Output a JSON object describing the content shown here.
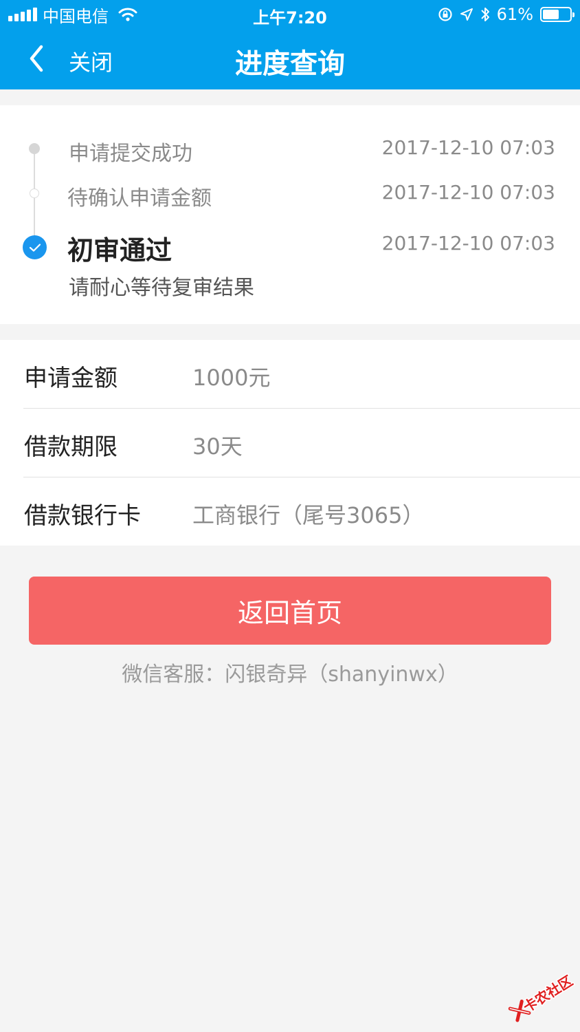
{
  "status_bar": {
    "carrier": "中国电信",
    "time": "上午7:20",
    "battery_text": "61%",
    "battery_level": 0.61
  },
  "nav": {
    "close_label": "关闭",
    "title": "进度查询"
  },
  "progress": {
    "steps": [
      {
        "label": "申请提交成功",
        "time": "2017-12-10 07:03"
      },
      {
        "label": "待确认申请金额",
        "time": "2017-12-10 07:03"
      },
      {
        "label": "初审通过",
        "time": "2017-12-10 07:03",
        "note": "请耐心等待复审结果"
      }
    ]
  },
  "details": {
    "rows": [
      {
        "label": "申请金额",
        "value": "1000元"
      },
      {
        "label": "借款期限",
        "value": "30天"
      },
      {
        "label": "借款银行卡",
        "value": "工商银行（尾号3065）"
      }
    ]
  },
  "actions": {
    "home_button": "返回首页",
    "wechat_service": "微信客服：闪银奇异（shanyinwx）"
  },
  "watermark": {
    "text": "卡农社区"
  },
  "colors": {
    "header_blue": "#03a0ec",
    "check_blue": "#1a96ee",
    "button_red": "#f56565",
    "page_bg": "#f4f4f4"
  }
}
